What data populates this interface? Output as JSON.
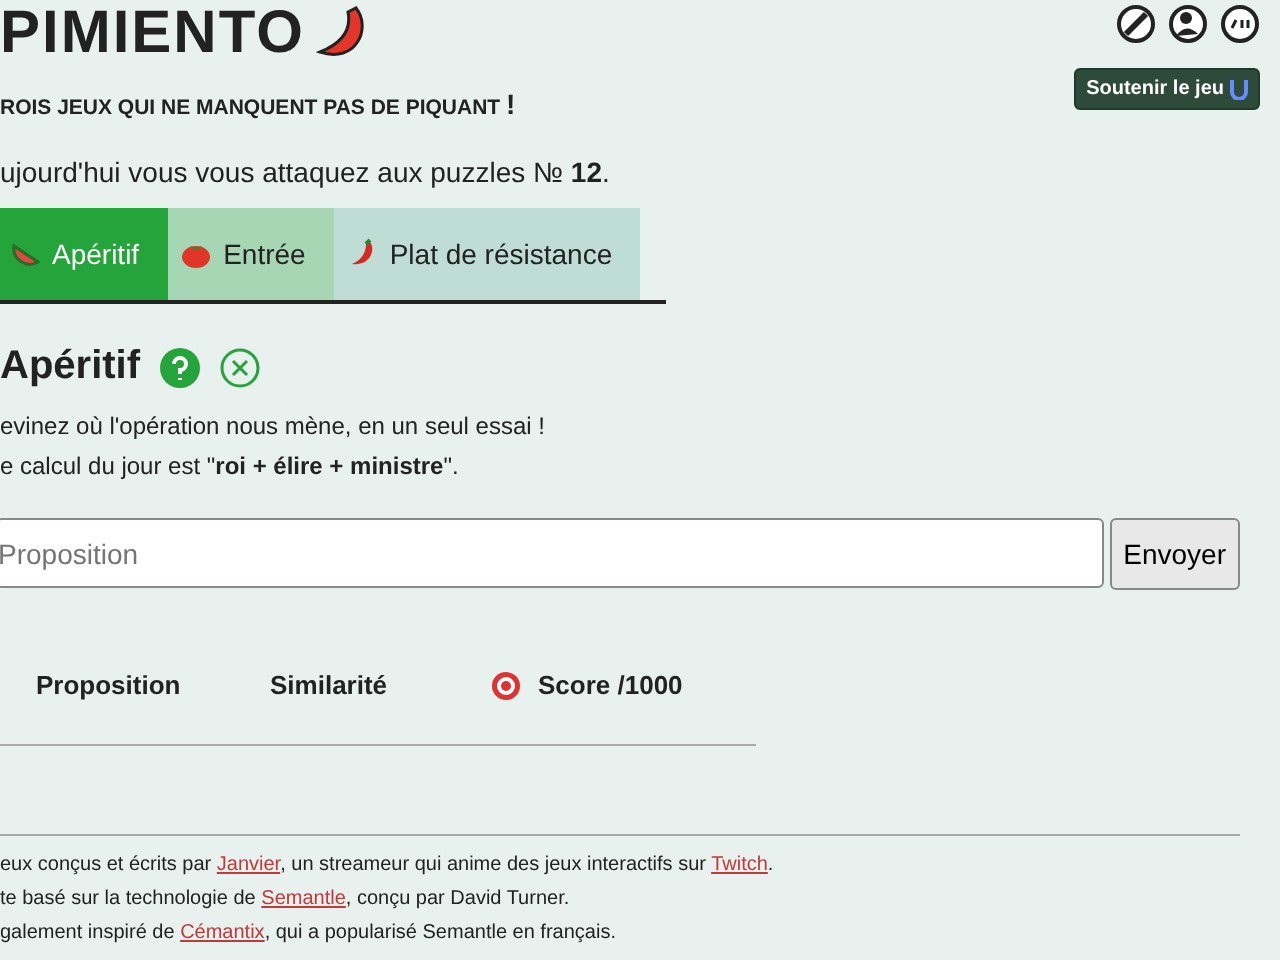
{
  "header": {
    "title": "PIMIENTO",
    "tagline": "ROIS JEUX QUI NE MANQUENT PAS DE PIQUANT",
    "tagline_mark": "!",
    "support_button": "Soutenir le jeu"
  },
  "intro": {
    "text": "ujourd'hui vous vous attaquez aux puzzles № **12**."
  },
  "tabs": [
    {
      "label": "Apéritif",
      "kind": "watermelon",
      "selected": true
    },
    {
      "label": "Entrée",
      "kind": "tomato",
      "selected": false
    },
    {
      "label": "Plat de résistance",
      "kind": "pepper",
      "selected": false
    }
  ],
  "puzzle": {
    "title": "Apéritif",
    "lines": [
      "evinez où l'opération nous mène, en un seul essai !",
      "e calcul du jour est \"**roi + élire + ministre**\"."
    ]
  },
  "form": {
    "placeholder": "Proposition",
    "button": "Envoyer"
  },
  "table": {
    "columns": [
      "Proposition",
      "Similarité",
      "Score /1000"
    ]
  },
  "footer": [
    [
      {
        "kind": "text",
        "text": "eux conçus et écrits par "
      },
      {
        "kind": "link",
        "text": "Janvier"
      },
      {
        "kind": "text",
        "text": ", un streameur qui anime des jeux interactifs sur "
      },
      {
        "kind": "link",
        "text": "Twitch"
      },
      {
        "kind": "text",
        "text": "."
      }
    ],
    [
      {
        "kind": "text",
        "text": "te basé sur la technologie de "
      },
      {
        "kind": "link",
        "text": "Semantle"
      },
      {
        "kind": "text",
        "text": ", conçu par David Turner."
      }
    ],
    [
      {
        "kind": "text",
        "text": "galement inspiré de "
      },
      {
        "kind": "link",
        "text": "Cémantix"
      },
      {
        "kind": "text",
        "text": ", qui a popularisé Semantle en français."
      }
    ]
  ]
}
